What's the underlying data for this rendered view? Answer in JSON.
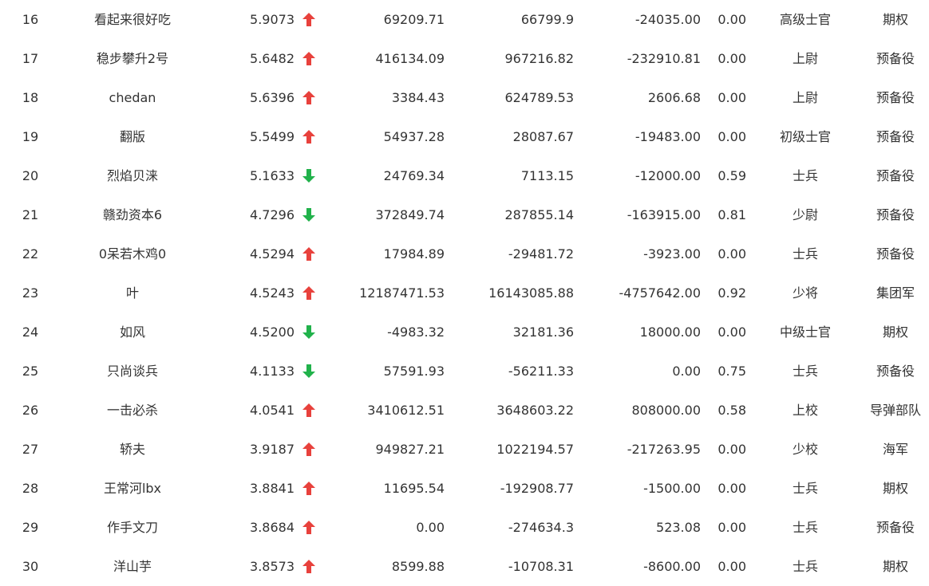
{
  "colors": {
    "up": "#e8413c",
    "down": "#21b24b",
    "text": "#333333"
  },
  "rows": [
    {
      "rank": "16",
      "name": "看起来很好吃",
      "score": "5.9073",
      "trend": "up",
      "v1": "69209.71",
      "v2": "66799.9",
      "v3": "-24035.00",
      "ratio": "0.00",
      "military_rank": "高级士官",
      "branch": "期权"
    },
    {
      "rank": "17",
      "name": "稳步攀升2号",
      "score": "5.6482",
      "trend": "up",
      "v1": "416134.09",
      "v2": "967216.82",
      "v3": "-232910.81",
      "ratio": "0.00",
      "military_rank": "上尉",
      "branch": "预备役"
    },
    {
      "rank": "18",
      "name": "chedan",
      "score": "5.6396",
      "trend": "up",
      "v1": "3384.43",
      "v2": "624789.53",
      "v3": "2606.68",
      "ratio": "0.00",
      "military_rank": "上尉",
      "branch": "预备役"
    },
    {
      "rank": "19",
      "name": "翻版",
      "score": "5.5499",
      "trend": "up",
      "v1": "54937.28",
      "v2": "28087.67",
      "v3": "-19483.00",
      "ratio": "0.00",
      "military_rank": "初级士官",
      "branch": "预备役"
    },
    {
      "rank": "20",
      "name": "烈焰贝涞",
      "score": "5.1633",
      "trend": "down",
      "v1": "24769.34",
      "v2": "7113.15",
      "v3": "-12000.00",
      "ratio": "0.59",
      "military_rank": "士兵",
      "branch": "预备役"
    },
    {
      "rank": "21",
      "name": "赣劲资本6",
      "score": "4.7296",
      "trend": "down",
      "v1": "372849.74",
      "v2": "287855.14",
      "v3": "-163915.00",
      "ratio": "0.81",
      "military_rank": "少尉",
      "branch": "预备役"
    },
    {
      "rank": "22",
      "name": "0呆若木鸡0",
      "score": "4.5294",
      "trend": "up",
      "v1": "17984.89",
      "v2": "-29481.72",
      "v3": "-3923.00",
      "ratio": "0.00",
      "military_rank": "士兵",
      "branch": "预备役"
    },
    {
      "rank": "23",
      "name": "叶",
      "score": "4.5243",
      "trend": "up",
      "v1": "12187471.53",
      "v2": "16143085.88",
      "v3": "-4757642.00",
      "ratio": "0.92",
      "military_rank": "少将",
      "branch": "集团军"
    },
    {
      "rank": "24",
      "name": "如风",
      "score": "4.5200",
      "trend": "down",
      "v1": "-4983.32",
      "v2": "32181.36",
      "v3": "18000.00",
      "ratio": "0.00",
      "military_rank": "中级士官",
      "branch": "期权"
    },
    {
      "rank": "25",
      "name": "只尚谈兵",
      "score": "4.1133",
      "trend": "down",
      "v1": "57591.93",
      "v2": "-56211.33",
      "v3": "0.00",
      "ratio": "0.75",
      "military_rank": "士兵",
      "branch": "预备役"
    },
    {
      "rank": "26",
      "name": "一击必杀",
      "score": "4.0541",
      "trend": "up",
      "v1": "3410612.51",
      "v2": "3648603.22",
      "v3": "808000.00",
      "ratio": "0.58",
      "military_rank": "上校",
      "branch": "导弹部队"
    },
    {
      "rank": "27",
      "name": "轿夫",
      "score": "3.9187",
      "trend": "up",
      "v1": "949827.21",
      "v2": "1022194.57",
      "v3": "-217263.95",
      "ratio": "0.00",
      "military_rank": "少校",
      "branch": "海军"
    },
    {
      "rank": "28",
      "name": "王常河lbx",
      "score": "3.8841",
      "trend": "up",
      "v1": "11695.54",
      "v2": "-192908.77",
      "v3": "-1500.00",
      "ratio": "0.00",
      "military_rank": "士兵",
      "branch": "期权"
    },
    {
      "rank": "29",
      "name": "作手文刀",
      "score": "3.8684",
      "trend": "up",
      "v1": "0.00",
      "v2": "-274634.3",
      "v3": "523.08",
      "ratio": "0.00",
      "military_rank": "士兵",
      "branch": "预备役"
    },
    {
      "rank": "30",
      "name": "洋山芋",
      "score": "3.8573",
      "trend": "up",
      "v1": "8599.88",
      "v2": "-10708.31",
      "v3": "-8600.00",
      "ratio": "0.00",
      "military_rank": "士兵",
      "branch": "期权"
    }
  ]
}
